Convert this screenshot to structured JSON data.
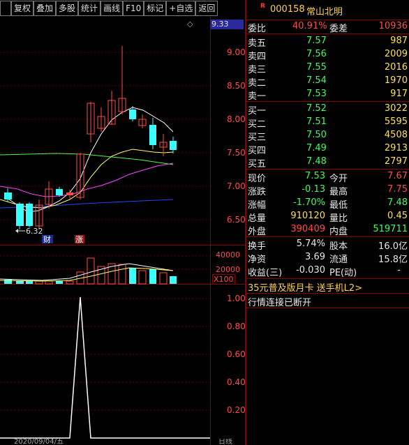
{
  "toolbar": {
    "buttons": [
      "复权",
      "叠加",
      "多股",
      "统计",
      "画线",
      "F10",
      "标记",
      "+自选",
      "返回"
    ]
  },
  "chart": {
    "price_axis": [
      "9.00",
      "8.50",
      "8.00",
      "7.50",
      "7.00",
      "6.50"
    ],
    "price_tag": "9.33",
    "low_marker": "6.32",
    "cai_tag": "财",
    "zhang_tag": "涨",
    "vol_axis": [
      "40000",
      "20000"
    ],
    "vol_unit": "X100",
    "ind_axis": [
      "1.00",
      "0.80",
      "0.60",
      "0.40",
      "0.20"
    ],
    "bottom_date": "2020/09/04/五",
    "bottom_right": "日线"
  },
  "quote": {
    "r_badge": "R",
    "code": "000158",
    "name": "常山北明",
    "weibi_label": "委比",
    "weibi": "40.91%",
    "weicha_label": "委差",
    "weicha": "10936",
    "asks": [
      {
        "label": "卖五",
        "price": "7.57",
        "vol": "987"
      },
      {
        "label": "卖四",
        "price": "7.56",
        "vol": "2009"
      },
      {
        "label": "卖三",
        "price": "7.55",
        "vol": "2016"
      },
      {
        "label": "卖二",
        "price": "7.54",
        "vol": "1970"
      },
      {
        "label": "卖一",
        "price": "7.53",
        "vol": "917"
      }
    ],
    "bids": [
      {
        "label": "买一",
        "price": "7.52",
        "vol": "3022"
      },
      {
        "label": "买二",
        "price": "7.51",
        "vol": "5595"
      },
      {
        "label": "买三",
        "price": "7.50",
        "vol": "4508"
      },
      {
        "label": "买四",
        "price": "7.49",
        "vol": "2913"
      },
      {
        "label": "买五",
        "price": "7.48",
        "vol": "2797"
      }
    ],
    "stats": [
      {
        "l1": "现价",
        "v1": "7.53",
        "l2": "今开",
        "v2": "7.67"
      },
      {
        "l1": "涨跌",
        "v1": "-0.13",
        "l2": "最高",
        "v2": "7.75"
      },
      {
        "l1": "涨幅",
        "v1": "-1.70%",
        "l2": "最低",
        "v2": "7.48"
      },
      {
        "l1": "总量",
        "v1": "910120",
        "l2": "量比",
        "v2": "0.45"
      },
      {
        "l1": "外盘",
        "v1": "390409",
        "l2": "内盘",
        "v2": "519711"
      }
    ],
    "extra": [
      {
        "l1": "换手",
        "v1": "5.74%",
        "l2": "股本",
        "v2": "16.0亿"
      },
      {
        "l1": "净资",
        "v1": "3.69",
        "l2": "流通",
        "v2": "15.8亿"
      },
      {
        "l1": "收益(三)",
        "v1": "-0.030",
        "l2": "PE(动)",
        "v2": "-"
      }
    ],
    "promo": "35元普及版月卡 送手机L2>",
    "status": "行情连接已断开"
  },
  "colors": {
    "up": "#ff4b4b",
    "down": "#3bffff",
    "ma5": "#ffffff",
    "ma10": "#ffff66",
    "ma20": "#ff44ff",
    "ma60": "#44ff44",
    "ma120": "#2244ff"
  }
}
